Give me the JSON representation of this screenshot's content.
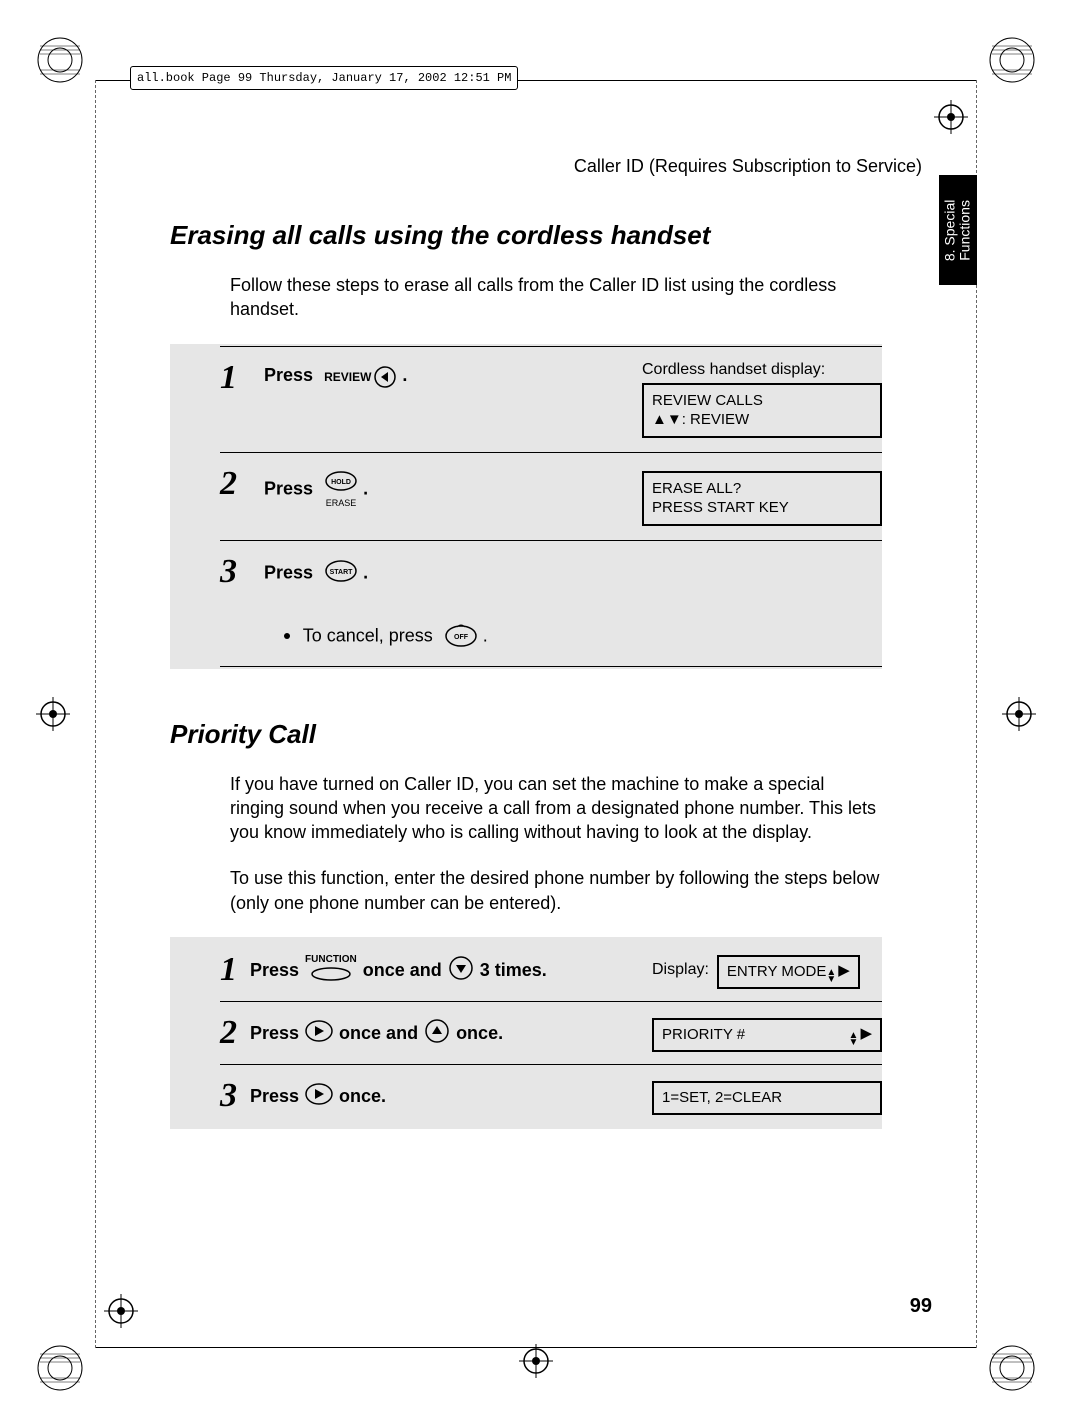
{
  "header_path": "all.book  Page 99  Thursday, January 17, 2002  12:51 PM",
  "running_head": "Caller ID (Requires Subscription to Service)",
  "side_tab": {
    "line1": "8. Special",
    "line2": "Functions"
  },
  "section1": {
    "title": "Erasing all calls using the cordless handset",
    "intro": "Follow these steps to erase all calls from the Caller ID list using the cordless handset.",
    "steps": [
      {
        "num": "1",
        "press_word": "Press",
        "button_label": "REVIEW",
        "dot": ".",
        "display_label": "Cordless handset display:",
        "display_line1": "REVIEW CALLS",
        "display_line2": "▲▼: REVIEW"
      },
      {
        "num": "2",
        "press_word": "Press",
        "button_top": "HOLD",
        "button_bottom": "ERASE",
        "dot": ".",
        "display_line1": "ERASE ALL?",
        "display_line2": "PRESS START KEY"
      },
      {
        "num": "3",
        "press_word": "Press",
        "button_label": "START",
        "dot": ".",
        "cancel_prefix": "To cancel, press",
        "cancel_button": "OFF",
        "cancel_dot": "."
      }
    ]
  },
  "section2": {
    "title": "Priority Call",
    "intro1": "If you have turned on Caller ID, you can set the machine to make a special ringing sound when you receive a call from a designated phone number. This lets you know immediately who is calling without having to look at the display.",
    "intro2": "To use this function, enter the desired phone number by following the steps below (only one phone number can be entered).",
    "steps": [
      {
        "num": "1",
        "seg1": "Press",
        "fn_label": "FUNCTION",
        "seg2": "once and",
        "seg3": "3 times.",
        "display_label": "Display:",
        "display_text": "ENTRY MODE"
      },
      {
        "num": "2",
        "seg1": "Press",
        "seg2": "once and",
        "seg3": "once.",
        "display_text": "PRIORITY #"
      },
      {
        "num": "3",
        "seg1": "Press",
        "seg2": "once.",
        "display_text": "1=SET, 2=CLEAR"
      }
    ]
  },
  "page_number": "99"
}
